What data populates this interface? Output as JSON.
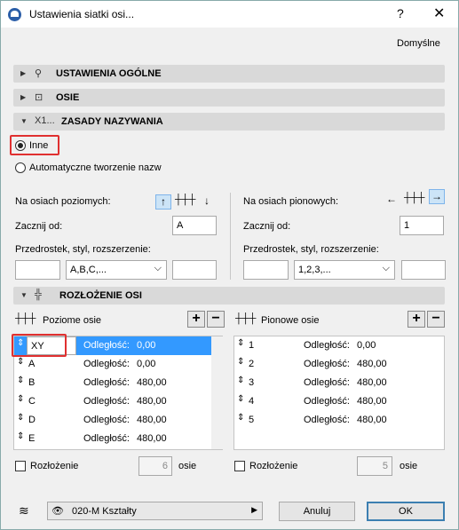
{
  "window": {
    "title": "Ustawienia siatki osi...",
    "help": "?",
    "close": "✕"
  },
  "defaults_label": "Domyślne",
  "sections": {
    "general": "USTAWIENIA OGÓLNE",
    "axes": "OSIE",
    "naming": "ZASADY NAZYWANIA",
    "layout": "ROZŁOŻENIE OSI",
    "naming_icon": "X1..."
  },
  "naming": {
    "other_label": "Inne",
    "auto_label": "Automatyczne tworzenie nazw",
    "selected": "other"
  },
  "horizontal": {
    "heading": "Na osiach poziomych:",
    "start_label": "Zacznij od:",
    "start_value": "A",
    "prefix_label": "Przedrostek, styl, rozszerzenie:",
    "prefix_value": "",
    "style_value": "A,B,C,...",
    "suffix_value": ""
  },
  "vertical": {
    "heading": "Na osiach pionowych:",
    "start_label": "Zacznij od:",
    "start_value": "1",
    "prefix_label": "Przedrostek, styl, rozszerzenie:",
    "prefix_value": "",
    "style_value": "1,2,3,...",
    "suffix_value": ""
  },
  "layout": {
    "h_axes_label": "Poziome osie",
    "v_axes_label": "Pionowe osie",
    "plus": "+",
    "minus": "−",
    "h_rows": [
      {
        "name": "XY",
        "dist_label": "Odległość:",
        "dist": "0,00"
      },
      {
        "name": "A",
        "dist_label": "Odległość:",
        "dist": "0,00"
      },
      {
        "name": "B",
        "dist_label": "Odległość:",
        "dist": "480,00"
      },
      {
        "name": "C",
        "dist_label": "Odległość:",
        "dist": "480,00"
      },
      {
        "name": "D",
        "dist_label": "Odległość:",
        "dist": "480,00"
      },
      {
        "name": "E",
        "dist_label": "Odległość:",
        "dist": "480,00"
      }
    ],
    "v_rows": [
      {
        "name": "1",
        "dist_label": "Odległość:",
        "dist": "0,00"
      },
      {
        "name": "2",
        "dist_label": "Odległość:",
        "dist": "480,00"
      },
      {
        "name": "3",
        "dist_label": "Odległość:",
        "dist": "480,00"
      },
      {
        "name": "4",
        "dist_label": "Odległość:",
        "dist": "480,00"
      },
      {
        "name": "5",
        "dist_label": "Odległość:",
        "dist": "480,00"
      }
    ],
    "h_distribution_label": "Rozłożenie",
    "h_distribution_count": "6",
    "h_distribution_unit": "osie",
    "v_distribution_label": "Rozłożenie",
    "v_distribution_count": "5",
    "v_distribution_unit": "osie"
  },
  "footer": {
    "layer_value": "020-M Kształty",
    "cancel_label": "Anuluj",
    "ok_label": "OK"
  },
  "colors": {
    "accent": "#3399ff",
    "highlight": "#e03030",
    "section_bg": "#d9d9d9"
  }
}
